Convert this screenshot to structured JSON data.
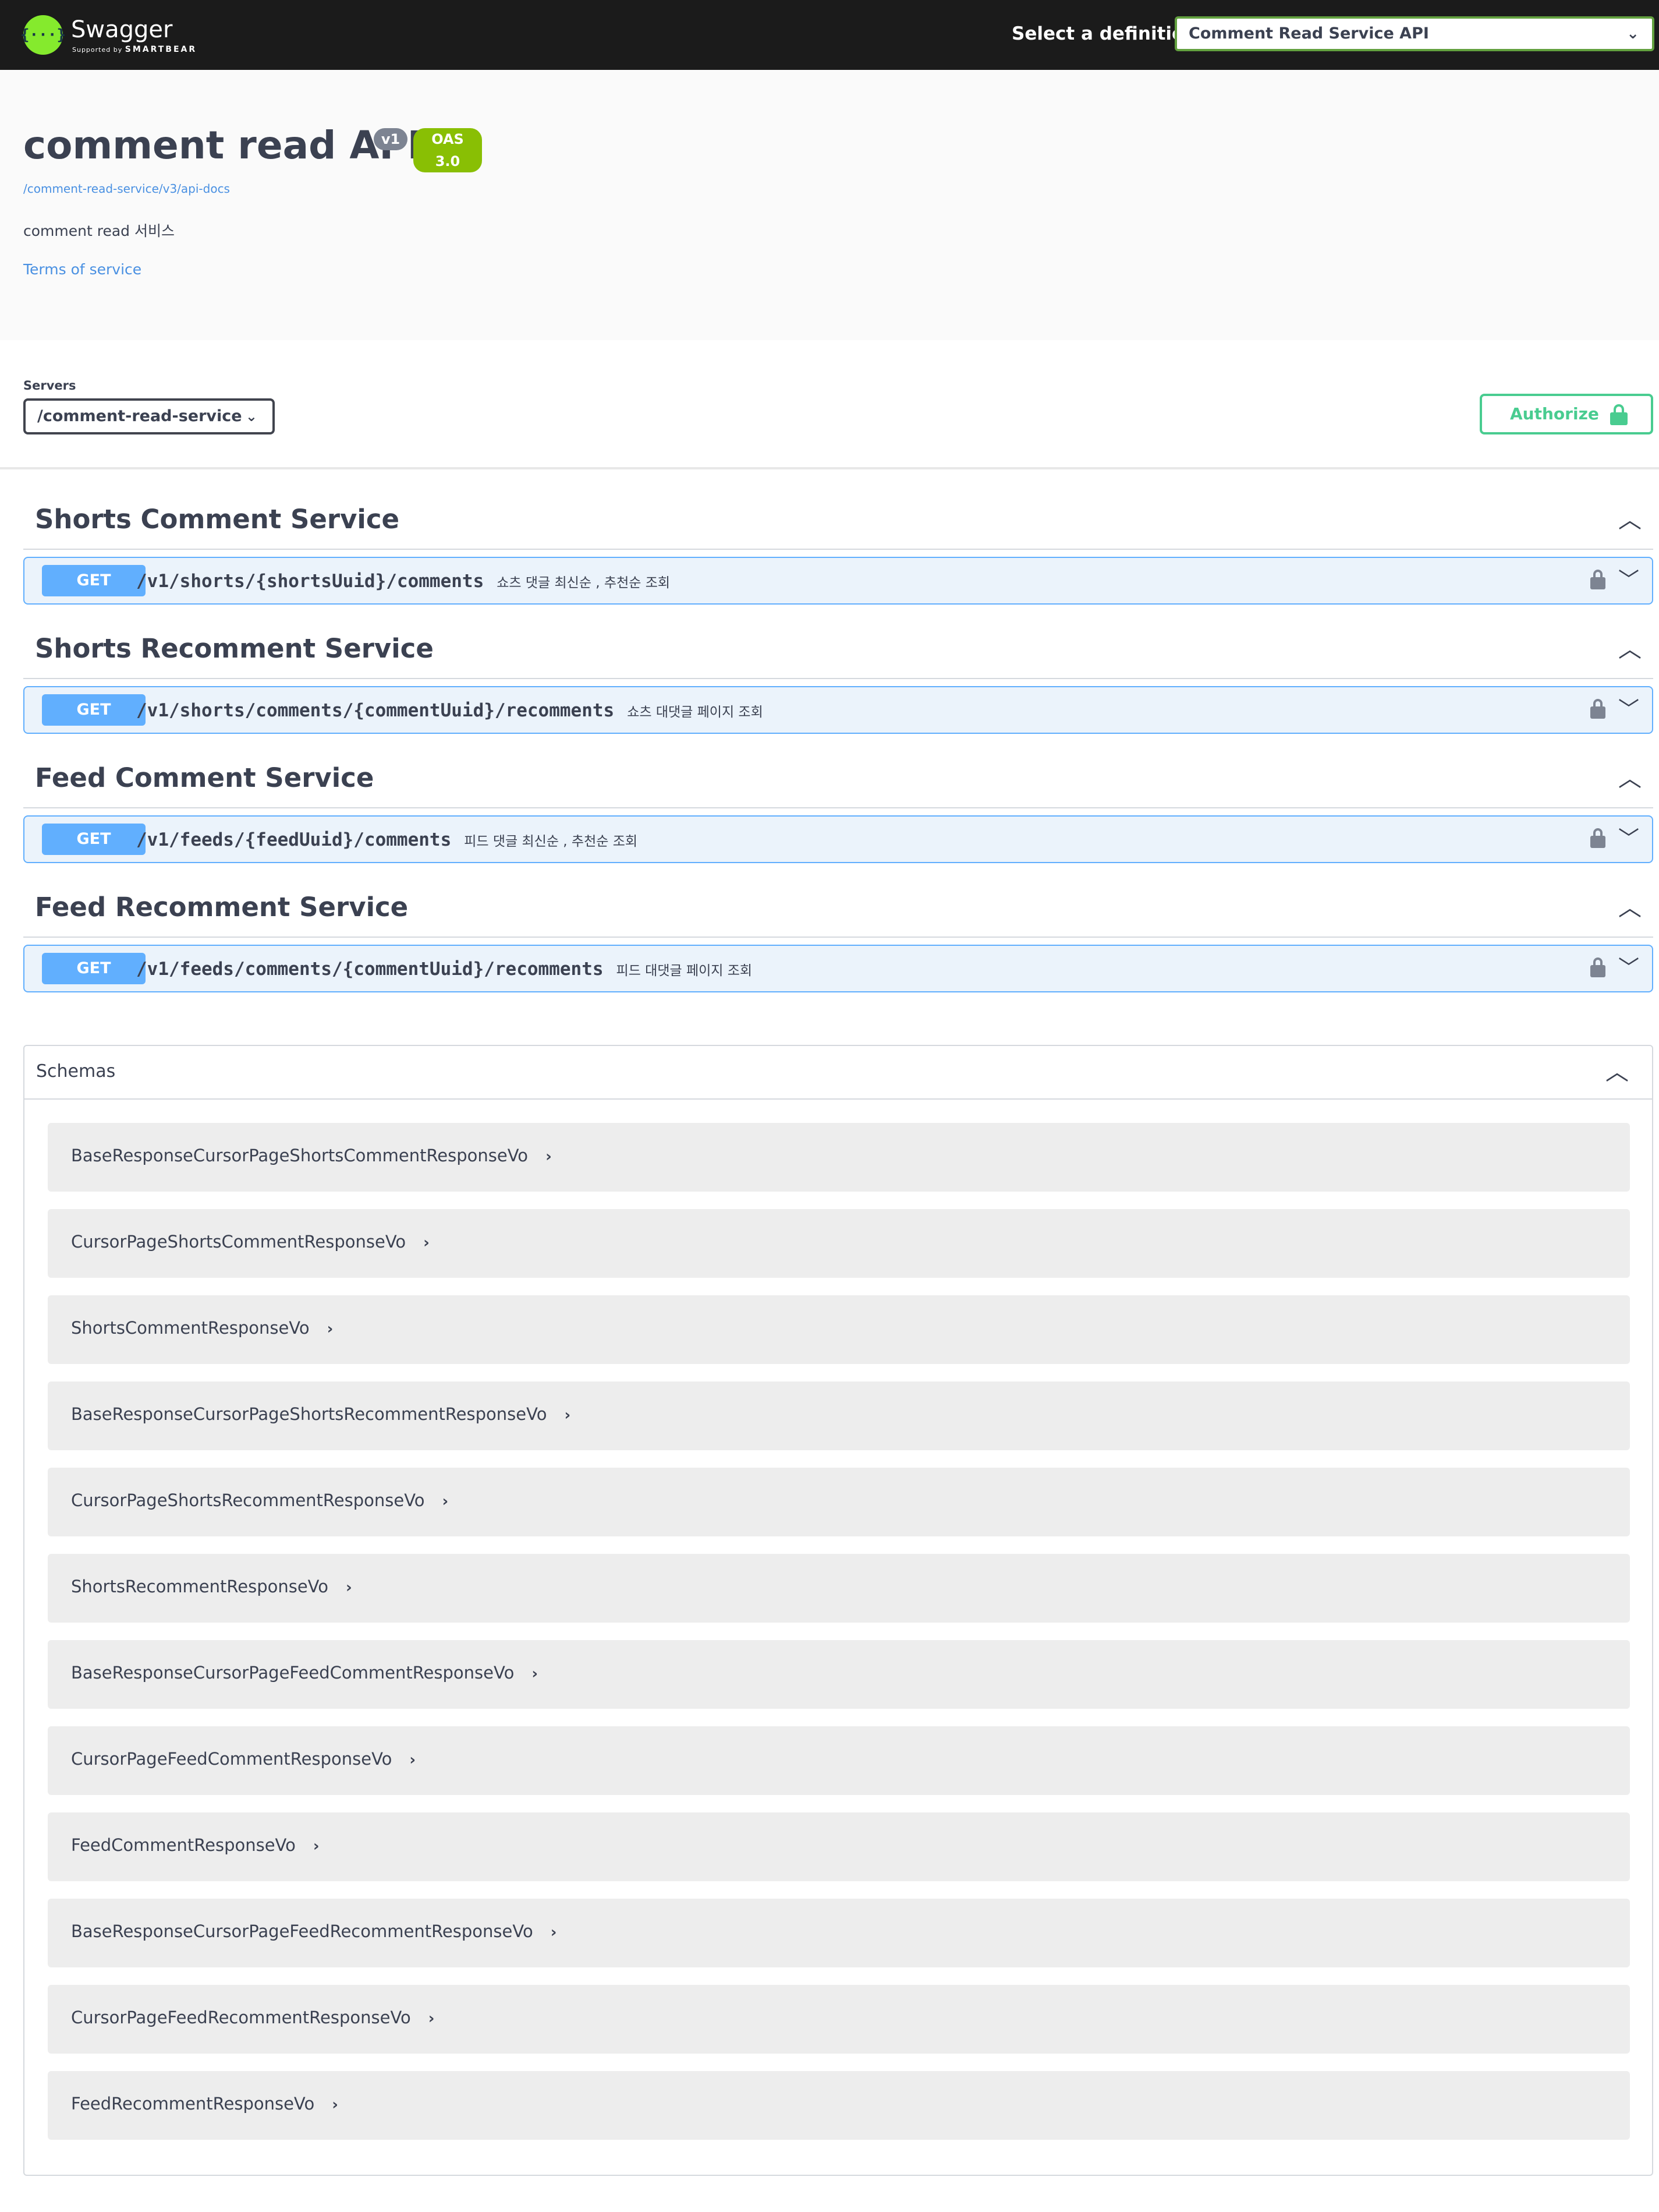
{
  "topbar": {
    "logo_name": "Swagger",
    "logo_sub_prefix": "Supported by",
    "logo_sub_brand": "SMARTBEAR",
    "definition_label": "Select a definition",
    "definition_value": "Comment Read Service API"
  },
  "info": {
    "title": "comment read API",
    "version_badge": "v1",
    "oas_badge": "OAS 3.0",
    "api_docs_link": "/comment-read-service/v3/api-docs",
    "description": "comment read 서비스",
    "terms_of_service": "Terms of service"
  },
  "servers": {
    "label": "Servers",
    "selected": "/comment-read-service",
    "authorize_label": "Authorize"
  },
  "sections": [
    {
      "title": "Shorts Comment Service",
      "operation": {
        "method": "GET",
        "path": "/v1/shorts/{shortsUuid}/comments",
        "summary": "쇼츠 댓글 최신순 , 추천순 조회"
      }
    },
    {
      "title": "Shorts Recomment Service",
      "operation": {
        "method": "GET",
        "path": "/v1/shorts/comments/{commentUuid}/recomments",
        "summary": "쇼츠 대댓글 페이지 조회"
      }
    },
    {
      "title": "Feed Comment Service",
      "operation": {
        "method": "GET",
        "path": "/v1/feeds/{feedUuid}/comments",
        "summary": "피드 댓글 최신순 , 추천순 조회"
      }
    },
    {
      "title": "Feed Recomment Service",
      "operation": {
        "method": "GET",
        "path": "/v1/feeds/comments/{commentUuid}/recomments",
        "summary": "피드 대댓글 페이지 조회"
      }
    }
  ],
  "schemas": {
    "title": "Schemas",
    "models": [
      "BaseResponseCursorPageShortsCommentResponseVo",
      "CursorPageShortsCommentResponseVo",
      "ShortsCommentResponseVo",
      "BaseResponseCursorPageShortsRecommentResponseVo",
      "CursorPageShortsRecommentResponseVo",
      "ShortsRecommentResponseVo",
      "BaseResponseCursorPageFeedCommentResponseVo",
      "CursorPageFeedCommentResponseVo",
      "FeedCommentResponseVo",
      "BaseResponseCursorPageFeedRecommentResponseVo",
      "CursorPageFeedRecommentResponseVo",
      "FeedRecommentResponseVo"
    ]
  },
  "icons": {
    "chevron_up": "chevron-up-icon",
    "chevron_down": "chevron-down-icon",
    "chevron_right": "chevron-right-icon",
    "lock": "lock-icon"
  },
  "colors": {
    "topbar_bg": "#1b1b1b",
    "get_method": "#61affe",
    "get_bg": "#ebf3fb",
    "authorize": "#49cc90",
    "oas_badge": "#89bf04",
    "link": "#4990e2"
  }
}
